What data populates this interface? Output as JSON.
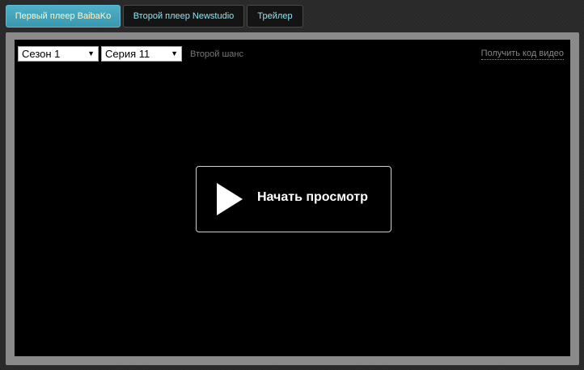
{
  "tabs": [
    {
      "label": "Первый плеер BaibaKo",
      "active": true
    },
    {
      "label": "Второй плеер Newstudio",
      "active": false
    },
    {
      "label": "Трейлер",
      "active": false
    }
  ],
  "player": {
    "season_select": {
      "value": "Сезон 1",
      "arrow": "▼"
    },
    "episode_select": {
      "value": "Серия 11",
      "arrow": "▼"
    },
    "episode_title": "Второй шанс",
    "get_code_link": "Получить код видео",
    "play_button_label": "Начать просмотр",
    "play_icon": "play-triangle-icon"
  },
  "colors": {
    "active_tab_bg": "#3a97b0",
    "active_tab_text": "#fff6c8",
    "inactive_tab_text": "#8fe6f2",
    "frame": "#8a8a8a",
    "screen": "#000000"
  }
}
